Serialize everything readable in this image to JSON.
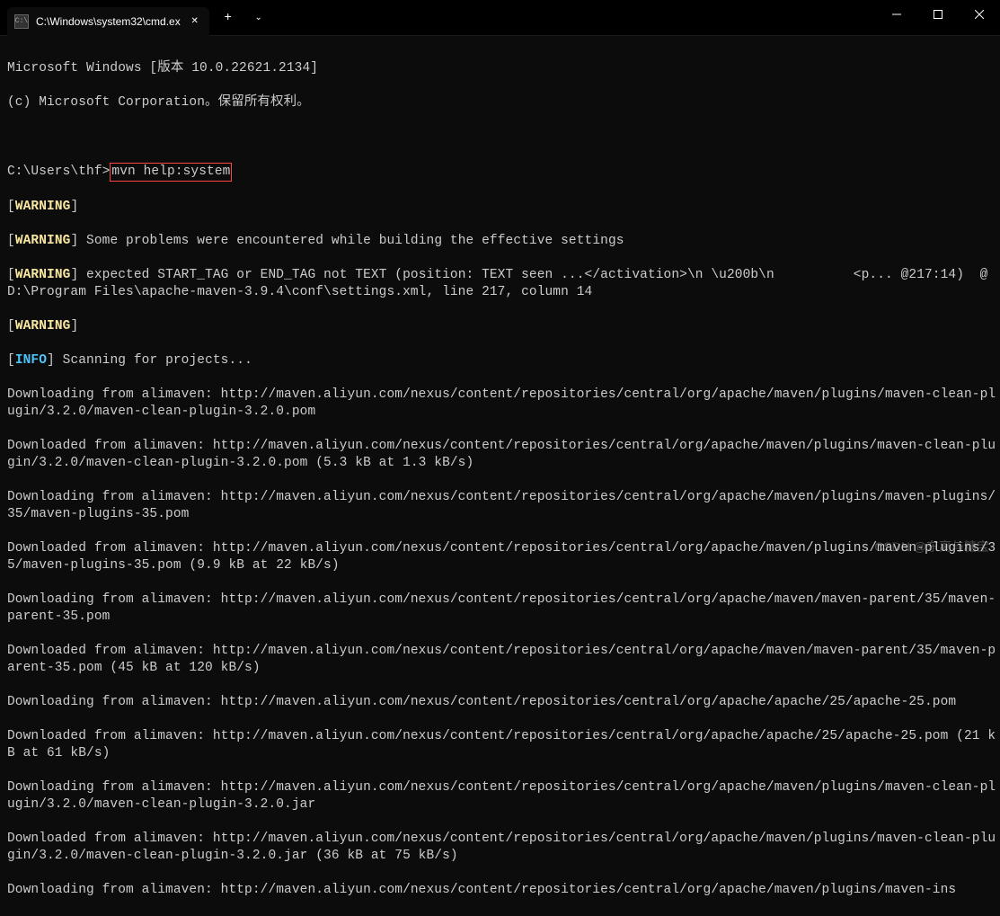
{
  "titlebar": {
    "tab_title": "C:\\Windows\\system32\\cmd.ex",
    "tab_icon_label": "cmd"
  },
  "terminal": {
    "header1": "Microsoft Windows [版本 10.0.22621.2134]",
    "header2": "(c) Microsoft Corporation。保留所有权利。",
    "prompt_prefix": "C:\\Users\\thf>",
    "command": "mvn help:system",
    "warning_label": "WARNING",
    "info_label": "INFO",
    "warn_line2": " Some problems were encountered while building the effective settings",
    "warn_line3": " expected START_TAG or END_TAG not TEXT (position: TEXT seen ...</activation>\\n \\u200b\\n          <p... @217:14)  @ D:\\Program Files\\apache-maven-3.9.4\\conf\\settings.xml, line 217, column 14",
    "info_line": " Scanning for projects...",
    "lines": [
      "Downloading from alimaven: http://maven.aliyun.com/nexus/content/repositories/central/org/apache/maven/plugins/maven-clean-plugin/3.2.0/maven-clean-plugin-3.2.0.pom",
      "Downloaded from alimaven: http://maven.aliyun.com/nexus/content/repositories/central/org/apache/maven/plugins/maven-clean-plugin/3.2.0/maven-clean-plugin-3.2.0.pom (5.3 kB at 1.3 kB/s)",
      "Downloading from alimaven: http://maven.aliyun.com/nexus/content/repositories/central/org/apache/maven/plugins/maven-plugins/35/maven-plugins-35.pom",
      "Downloaded from alimaven: http://maven.aliyun.com/nexus/content/repositories/central/org/apache/maven/plugins/maven-plugins/35/maven-plugins-35.pom (9.9 kB at 22 kB/s)",
      "Downloading from alimaven: http://maven.aliyun.com/nexus/content/repositories/central/org/apache/maven/maven-parent/35/maven-parent-35.pom",
      "Downloaded from alimaven: http://maven.aliyun.com/nexus/content/repositories/central/org/apache/maven/maven-parent/35/maven-parent-35.pom (45 kB at 120 kB/s)",
      "Downloading from alimaven: http://maven.aliyun.com/nexus/content/repositories/central/org/apache/apache/25/apache-25.pom",
      "Downloaded from alimaven: http://maven.aliyun.com/nexus/content/repositories/central/org/apache/apache/25/apache-25.pom (21 kB at 61 kB/s)",
      "Downloading from alimaven: http://maven.aliyun.com/nexus/content/repositories/central/org/apache/maven/plugins/maven-clean-plugin/3.2.0/maven-clean-plugin-3.2.0.jar",
      "Downloaded from alimaven: http://maven.aliyun.com/nexus/content/repositories/central/org/apache/maven/plugins/maven-clean-plugin/3.2.0/maven-clean-plugin-3.2.0.jar (36 kB at 75 kB/s)",
      "Downloading from alimaven: http://maven.aliyun.com/nexus/content/repositories/central/org/apache/maven/plugins/maven-ins"
    ]
  },
  "watermark": "CSDN @东离与糖宝"
}
